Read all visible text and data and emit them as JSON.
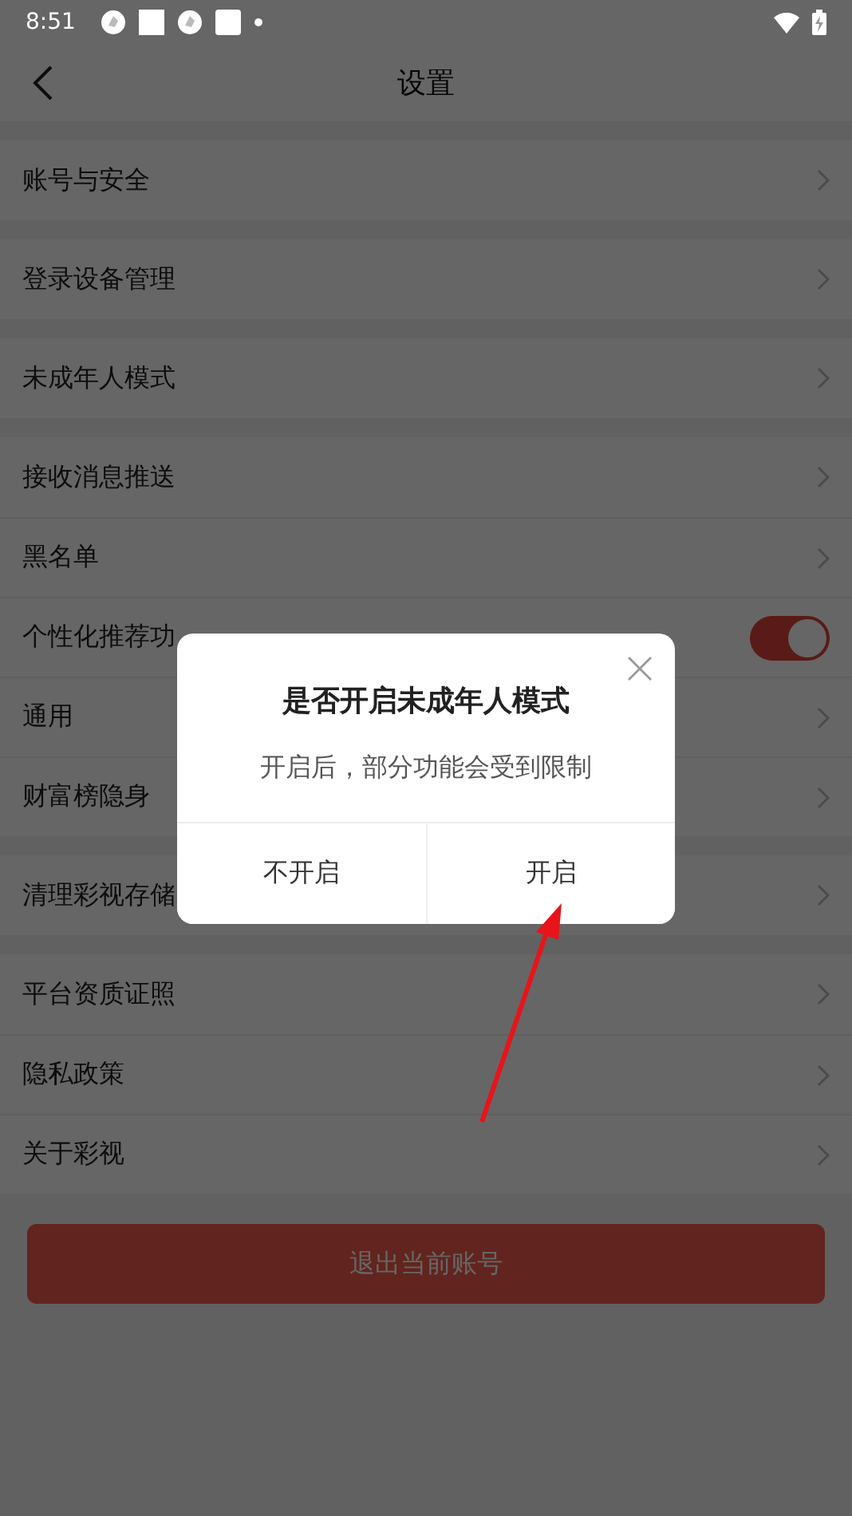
{
  "status_bar": {
    "time": "8:51"
  },
  "header": {
    "title": "设置"
  },
  "groups": [
    [
      {
        "label": "账号与安全",
        "kind": "link"
      }
    ],
    [
      {
        "label": "登录设备管理",
        "kind": "link"
      }
    ],
    [
      {
        "label": "未成年人模式",
        "kind": "link"
      }
    ],
    [
      {
        "label": "接收消息推送",
        "kind": "link"
      },
      {
        "label": "黑名单",
        "kind": "link"
      },
      {
        "label": "个性化推荐功",
        "kind": "toggle",
        "on": true
      },
      {
        "label": "通用",
        "kind": "link"
      },
      {
        "label": "财富榜隐身",
        "kind": "link"
      }
    ],
    [
      {
        "label": "清理彩视存储",
        "kind": "link"
      }
    ],
    [
      {
        "label": "平台资质证照",
        "kind": "link"
      },
      {
        "label": "隐私政策",
        "kind": "link"
      },
      {
        "label": "关于彩视",
        "kind": "link"
      }
    ]
  ],
  "logout_button": "退出当前账号",
  "dialog": {
    "title": "是否开启未成年人模式",
    "message": "开启后，部分功能会受到限制",
    "buttons": [
      "不开启",
      "开启"
    ]
  }
}
